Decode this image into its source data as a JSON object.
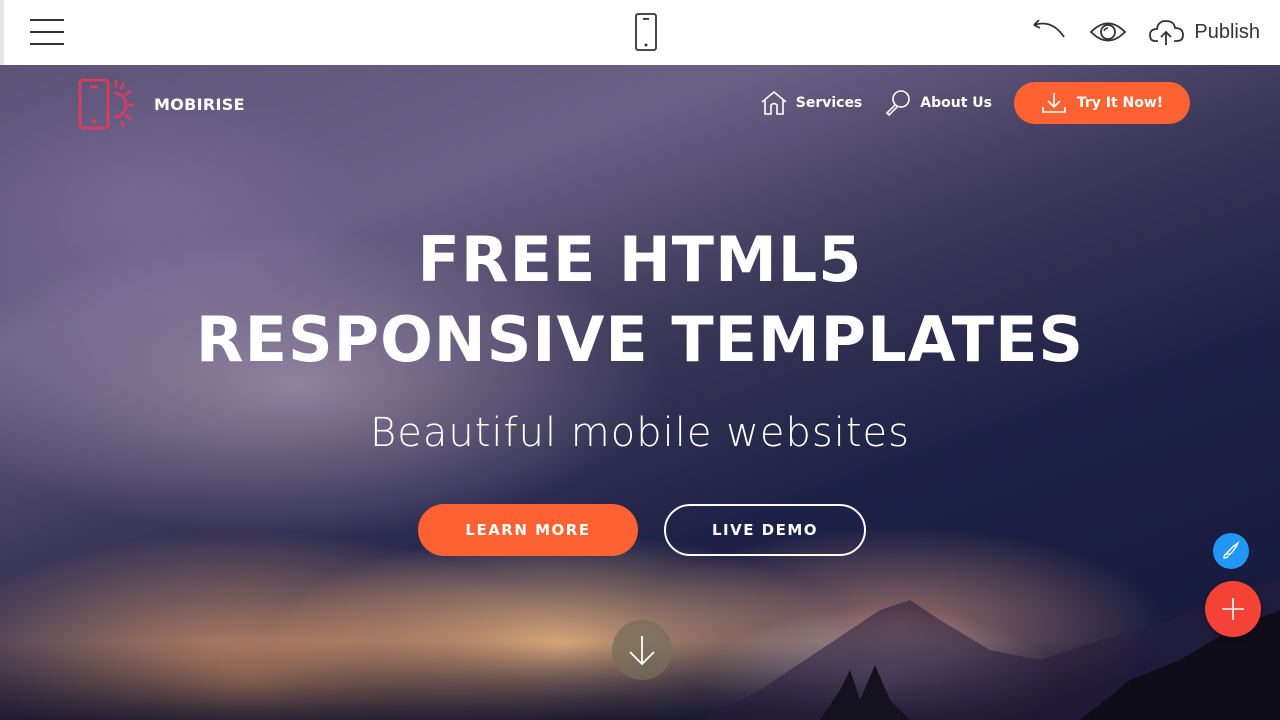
{
  "toolbar": {
    "menu_icon": "hamburger-icon",
    "device_icon": "mobile-phone-icon",
    "undo_icon": "undo-icon",
    "preview_icon": "eye-icon",
    "publish_icon": "cloud-upload-icon",
    "publish_label": "Publish"
  },
  "site": {
    "brand": {
      "logo_icon": "phone-sun-logo-icon",
      "name": "MOBIRISE",
      "logo_color": "#e8385a"
    },
    "nav": [
      {
        "label": "Services",
        "icon": "home-icon"
      },
      {
        "label": "About Us",
        "icon": "search-icon"
      }
    ],
    "try_button": {
      "label": "Try It Now!",
      "icon": "download-icon"
    },
    "hero": {
      "title_line1": "FREE HTML5",
      "title_line2": "RESPONSIVE TEMPLATES",
      "subtitle": "Beautiful mobile websites",
      "buttons": [
        {
          "label": "LEARN MORE",
          "style": "filled"
        },
        {
          "label": "LIVE DEMO",
          "style": "outline"
        }
      ],
      "scroll_icon": "arrow-down-icon"
    }
  },
  "fabs": {
    "style_icon": "brush-icon",
    "add_icon": "plus-icon"
  },
  "colors": {
    "accent": "#ff6232",
    "fab_blue": "#2196f3",
    "fab_red": "#f44336"
  }
}
